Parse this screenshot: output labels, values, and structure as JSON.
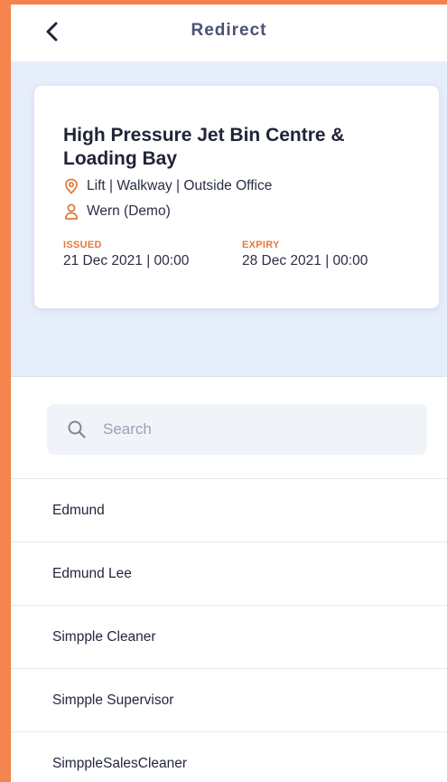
{
  "header": {
    "title": "Redirect",
    "back_icon": "chevron-left-icon"
  },
  "card": {
    "title": "High Pressure Jet Bin Centre & Loading Bay",
    "location_icon": "location-pin-icon",
    "location": "Lift | Walkway | Outside Office",
    "person_icon": "person-icon",
    "person": "Wern (Demo)",
    "issued_label": "ISSUED",
    "issued_value": "21 Dec 2021 | 00:00",
    "expiry_label": "EXPIRY",
    "expiry_value": "28 Dec 2021 | 00:00"
  },
  "search": {
    "placeholder": "Search",
    "value": "",
    "icon": "search-icon"
  },
  "list": {
    "items": [
      {
        "label": "Edmund"
      },
      {
        "label": "Edmund Lee"
      },
      {
        "label": "Simpple Cleaner"
      },
      {
        "label": "Simpple Supervisor"
      },
      {
        "label": "SimppleSalesCleaner"
      }
    ]
  },
  "colors": {
    "frame": "#f4844c",
    "accent": "#e07a3f",
    "hero_bg": "#e6edfb",
    "title_text": "#4a5275"
  }
}
